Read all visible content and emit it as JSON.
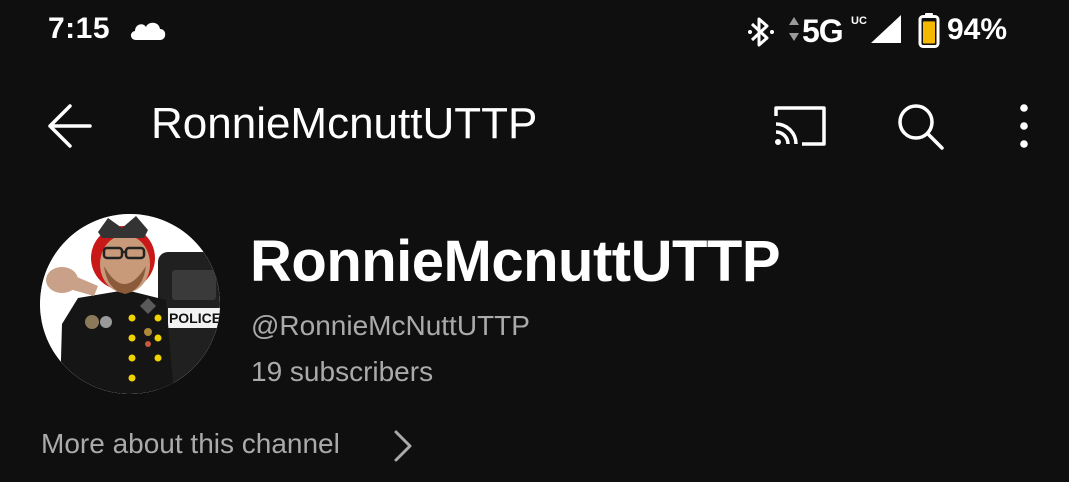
{
  "status_bar": {
    "time": "7:15",
    "weather_icon": "cloud-icon",
    "bluetooth_icon": "bluetooth-icon",
    "network": "5G",
    "network_suffix": "UC",
    "signal_icon": "signal-icon",
    "battery_icon": "battery-icon",
    "battery_percent": "94%",
    "battery_level": 0.94,
    "battery_color": "#f5b800"
  },
  "app_bar": {
    "title": "RonnieMcnuttUTTP",
    "back_icon": "arrow-back-icon",
    "cast_icon": "cast-icon",
    "search_icon": "search-icon",
    "more_icon": "more-vert-icon"
  },
  "channel": {
    "name": "RonnieMcnuttUTTP",
    "handle": "@RonnieMcNuttUTTP",
    "subscribers": "19 subscribers",
    "avatar_badge": "POLICE",
    "more_about": "More about this channel",
    "more_about_icon": "chevron-right-icon"
  },
  "colors": {
    "background": "#0f0f0f",
    "text_primary": "#ffffff",
    "text_secondary": "#aaaaaa"
  }
}
